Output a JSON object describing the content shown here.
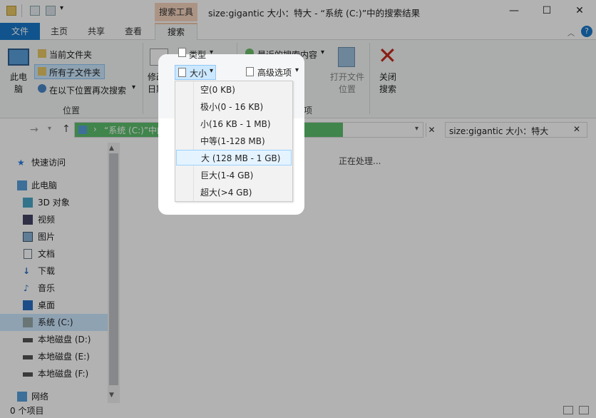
{
  "window": {
    "title": "size:gigantic 大小：特大 - “系统 (C:)”中的搜索结果",
    "context_tab_header": "搜索工具",
    "controls": [
      "—",
      "☐",
      "✕"
    ]
  },
  "ribbon_tabs": {
    "file": "文件",
    "home": "主页",
    "share": "共享",
    "view": "查看",
    "search": "搜索"
  },
  "ribbon": {
    "location": {
      "this_pc": "此电脑",
      "current_folder": "当前文件夹",
      "all_subfolders": "所有子文件夹",
      "search_again_in": "在以下位置再次搜索",
      "group_label": "位置"
    },
    "refine": {
      "date_modified": "修改日期",
      "kind": "类型",
      "size": "大小"
    },
    "options": {
      "recent_searches": "最近的搜索内容",
      "advanced_options": "高级选项",
      "group_label": "选项",
      "open_file_location": "打开文件位置",
      "close_search": "关闭搜索"
    }
  },
  "address_bar": {
    "path": "“系统 (C:)”中的搜索",
    "search_query": "size:gigantic 大小：特大"
  },
  "size_menu": {
    "items": [
      "空(0 KB)",
      "极小(0 - 16 KB)",
      "小(16 KB - 1 MB)",
      "中等(1-128 MB)",
      "大 (128 MB - 1 GB)",
      "巨大(1-4 GB)",
      "超大(>4 GB)"
    ],
    "highlighted_index": 4
  },
  "nav_pane": {
    "quick_access": "快速访问",
    "this_pc": "此电脑",
    "items": [
      "3D 对象",
      "视频",
      "图片",
      "文档",
      "下载",
      "音乐",
      "桌面",
      "系统 (C:)",
      "本地磁盘 (D:)",
      "本地磁盘 (E:)",
      "本地磁盘 (F:)"
    ],
    "network": "网络"
  },
  "content": {
    "processing": "正在处理..."
  },
  "status_bar": {
    "item_count": "0 个项目"
  },
  "colors": {
    "file_tab": "#1979ca",
    "context_tab": "#f6d5bf",
    "progress": "#5cbf6c",
    "selection": "#cce8ff",
    "close_x": "#c42b1c"
  }
}
